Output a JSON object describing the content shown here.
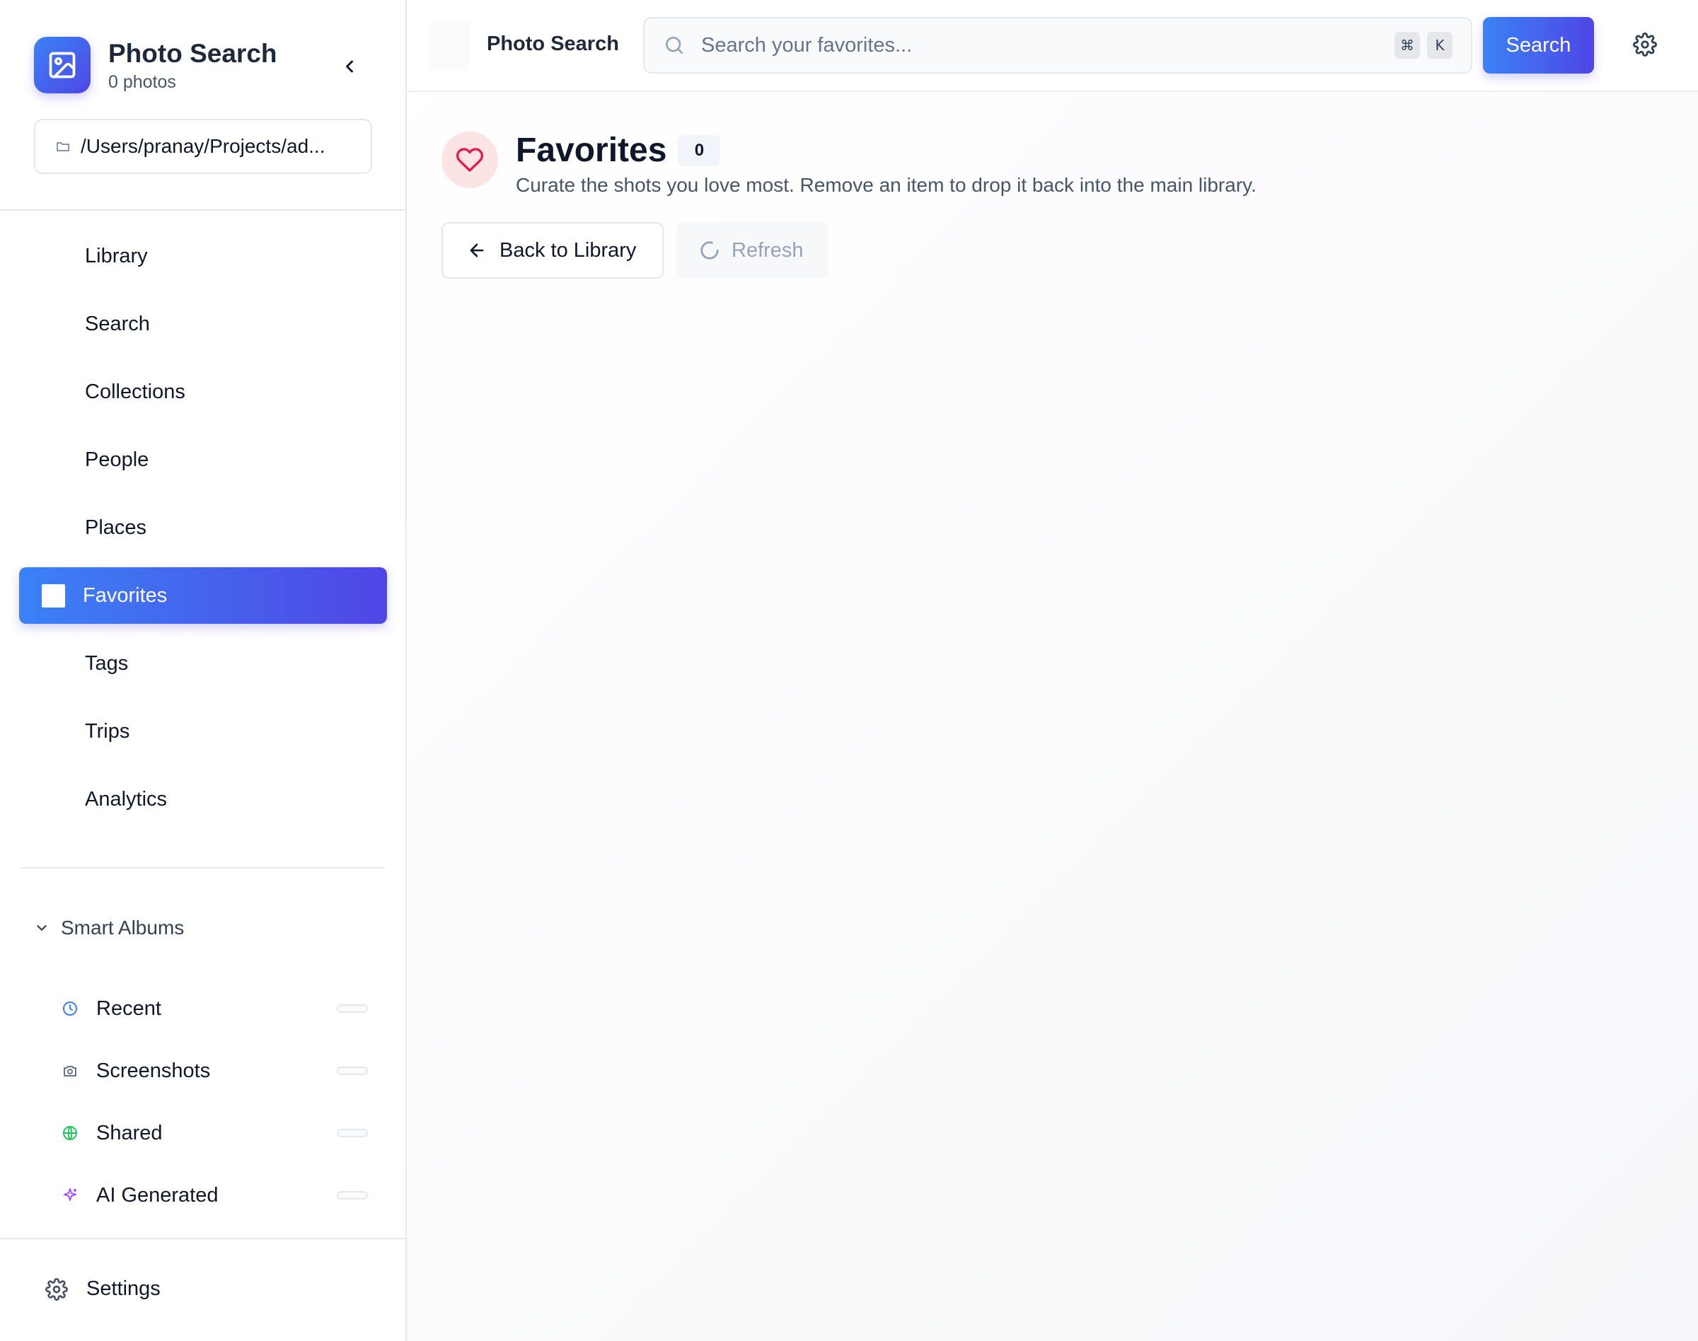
{
  "sidebar": {
    "app_title": "Photo Search",
    "photo_count": "0 photos",
    "library_path": "/Users/pranay/Projects/ad...",
    "nav_items": [
      {
        "label": "Library"
      },
      {
        "label": "Search"
      },
      {
        "label": "Collections"
      },
      {
        "label": "People"
      },
      {
        "label": "Places"
      },
      {
        "label": "Favorites",
        "active": true
      },
      {
        "label": "Tags"
      },
      {
        "label": "Trips"
      },
      {
        "label": "Analytics"
      }
    ],
    "smart_albums": {
      "header": "Smart Albums",
      "items": [
        {
          "label": "Recent",
          "icon": "clock-icon",
          "color": "#3b82f6"
        },
        {
          "label": "Screenshots",
          "icon": "camera-icon",
          "color": "#64748b"
        },
        {
          "label": "Shared",
          "icon": "globe-icon",
          "color": "#22c55e"
        },
        {
          "label": "AI Generated",
          "icon": "sparkles-icon",
          "color": "#a855f7"
        }
      ]
    },
    "settings_label": "Settings"
  },
  "topbar": {
    "title": "Photo Search",
    "search_placeholder": "Search your favorites...",
    "shortcut_keys": [
      "⌘",
      "K"
    ],
    "search_button": "Search"
  },
  "page": {
    "title": "Favorites",
    "count": "0",
    "description": "Curate the shots you love most. Remove an item to drop it back into the main library.",
    "back_button": "Back to Library",
    "refresh_button": "Refresh"
  },
  "colors": {
    "accent_start": "#3b82f6",
    "accent_end": "#4f46e5",
    "heart": "#e11d48"
  }
}
